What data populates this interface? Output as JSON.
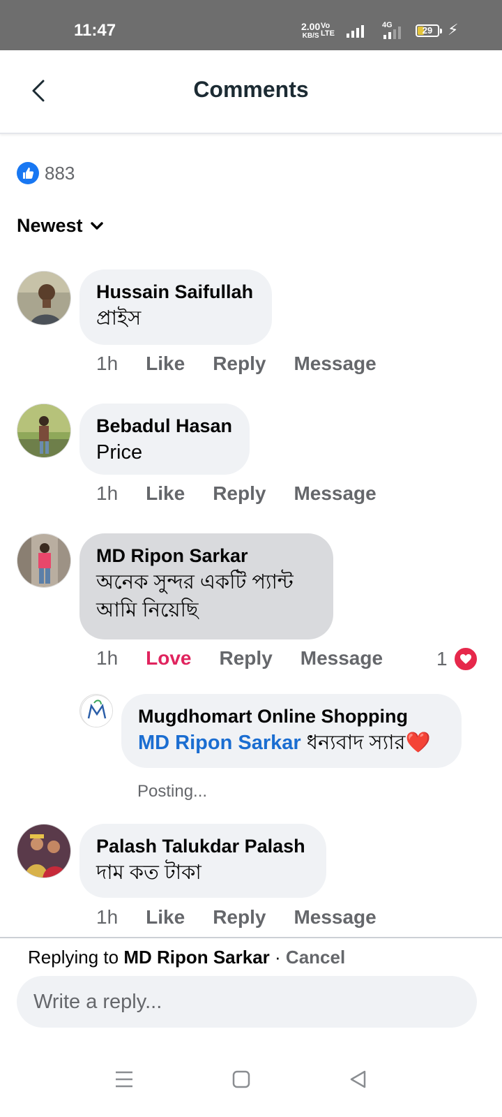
{
  "status_bar": {
    "time": "11:47",
    "speed_value": "2.00",
    "speed_unit": "KB/S",
    "volte_top": "Vo",
    "volte_bottom": "LTE",
    "network": "4G",
    "battery": "29"
  },
  "header": {
    "title": "Comments",
    "back_icon": "chevron-left-icon"
  },
  "reactions": {
    "icon": "thumbs-up-icon",
    "count": "883"
  },
  "sort": {
    "label": "Newest"
  },
  "comments": [
    {
      "author": "Hussain Saifullah",
      "text": "প্রাইস",
      "time": "1h",
      "action_react": "Like",
      "action_reply": "Reply",
      "action_message": "Message"
    },
    {
      "author": "Bebadul Hasan",
      "text": "Price",
      "time": "1h",
      "action_react": "Like",
      "action_reply": "Reply",
      "action_message": "Message"
    },
    {
      "author": "MD Ripon Sarkar",
      "text_line1": "অনেক সুন্দর একটি প্যান্ট",
      "text_line2": "আমি নিয়েছি",
      "time": "1h",
      "action_react": "Love",
      "action_reply": "Reply",
      "action_message": "Message",
      "reaction_count": "1",
      "reaction_icon": "heart-icon"
    },
    {
      "author": "Palash Talukdar Palash",
      "text": "দাম কত টাকা",
      "time": "1h",
      "action_react": "Like",
      "action_reply": "Reply",
      "action_message": "Message"
    }
  ],
  "reply": {
    "author": "Mugdhomart Online Shopping",
    "mention": "MD Ripon Sarkar",
    "text": " ধন্যবাদ স্যার",
    "emoji": "❤️",
    "status": "Posting..."
  },
  "composer": {
    "replying_prefix": "Replying to ",
    "replying_name": "MD Ripon Sarkar",
    "separator": " · ",
    "cancel": "Cancel",
    "placeholder": "Write a reply..."
  },
  "navbar": {
    "menu_icon": "menu-icon",
    "home_icon": "home-square-icon",
    "back_icon": "back-triangle-icon"
  }
}
